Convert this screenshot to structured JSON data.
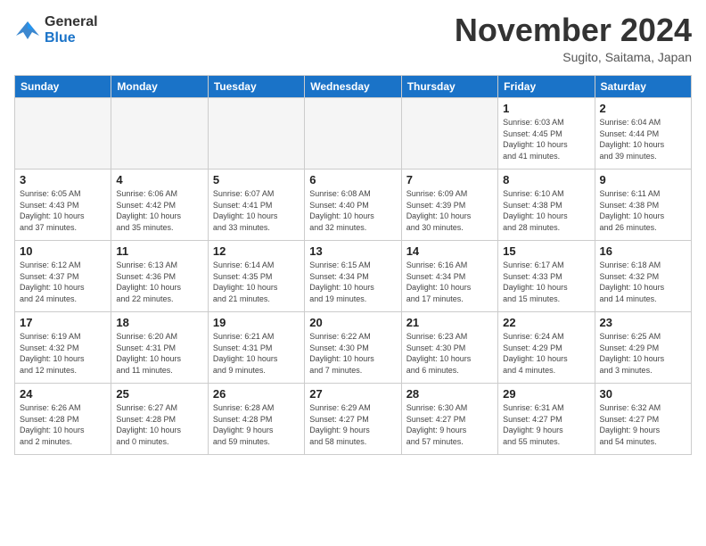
{
  "logo": {
    "line1": "General",
    "line2": "Blue"
  },
  "title": "November 2024",
  "subtitle": "Sugito, Saitama, Japan",
  "days_of_week": [
    "Sunday",
    "Monday",
    "Tuesday",
    "Wednesday",
    "Thursday",
    "Friday",
    "Saturday"
  ],
  "weeks": [
    [
      {
        "day": "",
        "info": ""
      },
      {
        "day": "",
        "info": ""
      },
      {
        "day": "",
        "info": ""
      },
      {
        "day": "",
        "info": ""
      },
      {
        "day": "",
        "info": ""
      },
      {
        "day": "1",
        "info": "Sunrise: 6:03 AM\nSunset: 4:45 PM\nDaylight: 10 hours\nand 41 minutes."
      },
      {
        "day": "2",
        "info": "Sunrise: 6:04 AM\nSunset: 4:44 PM\nDaylight: 10 hours\nand 39 minutes."
      }
    ],
    [
      {
        "day": "3",
        "info": "Sunrise: 6:05 AM\nSunset: 4:43 PM\nDaylight: 10 hours\nand 37 minutes."
      },
      {
        "day": "4",
        "info": "Sunrise: 6:06 AM\nSunset: 4:42 PM\nDaylight: 10 hours\nand 35 minutes."
      },
      {
        "day": "5",
        "info": "Sunrise: 6:07 AM\nSunset: 4:41 PM\nDaylight: 10 hours\nand 33 minutes."
      },
      {
        "day": "6",
        "info": "Sunrise: 6:08 AM\nSunset: 4:40 PM\nDaylight: 10 hours\nand 32 minutes."
      },
      {
        "day": "7",
        "info": "Sunrise: 6:09 AM\nSunset: 4:39 PM\nDaylight: 10 hours\nand 30 minutes."
      },
      {
        "day": "8",
        "info": "Sunrise: 6:10 AM\nSunset: 4:38 PM\nDaylight: 10 hours\nand 28 minutes."
      },
      {
        "day": "9",
        "info": "Sunrise: 6:11 AM\nSunset: 4:38 PM\nDaylight: 10 hours\nand 26 minutes."
      }
    ],
    [
      {
        "day": "10",
        "info": "Sunrise: 6:12 AM\nSunset: 4:37 PM\nDaylight: 10 hours\nand 24 minutes."
      },
      {
        "day": "11",
        "info": "Sunrise: 6:13 AM\nSunset: 4:36 PM\nDaylight: 10 hours\nand 22 minutes."
      },
      {
        "day": "12",
        "info": "Sunrise: 6:14 AM\nSunset: 4:35 PM\nDaylight: 10 hours\nand 21 minutes."
      },
      {
        "day": "13",
        "info": "Sunrise: 6:15 AM\nSunset: 4:34 PM\nDaylight: 10 hours\nand 19 minutes."
      },
      {
        "day": "14",
        "info": "Sunrise: 6:16 AM\nSunset: 4:34 PM\nDaylight: 10 hours\nand 17 minutes."
      },
      {
        "day": "15",
        "info": "Sunrise: 6:17 AM\nSunset: 4:33 PM\nDaylight: 10 hours\nand 15 minutes."
      },
      {
        "day": "16",
        "info": "Sunrise: 6:18 AM\nSunset: 4:32 PM\nDaylight: 10 hours\nand 14 minutes."
      }
    ],
    [
      {
        "day": "17",
        "info": "Sunrise: 6:19 AM\nSunset: 4:32 PM\nDaylight: 10 hours\nand 12 minutes."
      },
      {
        "day": "18",
        "info": "Sunrise: 6:20 AM\nSunset: 4:31 PM\nDaylight: 10 hours\nand 11 minutes."
      },
      {
        "day": "19",
        "info": "Sunrise: 6:21 AM\nSunset: 4:31 PM\nDaylight: 10 hours\nand 9 minutes."
      },
      {
        "day": "20",
        "info": "Sunrise: 6:22 AM\nSunset: 4:30 PM\nDaylight: 10 hours\nand 7 minutes."
      },
      {
        "day": "21",
        "info": "Sunrise: 6:23 AM\nSunset: 4:30 PM\nDaylight: 10 hours\nand 6 minutes."
      },
      {
        "day": "22",
        "info": "Sunrise: 6:24 AM\nSunset: 4:29 PM\nDaylight: 10 hours\nand 4 minutes."
      },
      {
        "day": "23",
        "info": "Sunrise: 6:25 AM\nSunset: 4:29 PM\nDaylight: 10 hours\nand 3 minutes."
      }
    ],
    [
      {
        "day": "24",
        "info": "Sunrise: 6:26 AM\nSunset: 4:28 PM\nDaylight: 10 hours\nand 2 minutes."
      },
      {
        "day": "25",
        "info": "Sunrise: 6:27 AM\nSunset: 4:28 PM\nDaylight: 10 hours\nand 0 minutes."
      },
      {
        "day": "26",
        "info": "Sunrise: 6:28 AM\nSunset: 4:28 PM\nDaylight: 9 hours\nand 59 minutes."
      },
      {
        "day": "27",
        "info": "Sunrise: 6:29 AM\nSunset: 4:27 PM\nDaylight: 9 hours\nand 58 minutes."
      },
      {
        "day": "28",
        "info": "Sunrise: 6:30 AM\nSunset: 4:27 PM\nDaylight: 9 hours\nand 57 minutes."
      },
      {
        "day": "29",
        "info": "Sunrise: 6:31 AM\nSunset: 4:27 PM\nDaylight: 9 hours\nand 55 minutes."
      },
      {
        "day": "30",
        "info": "Sunrise: 6:32 AM\nSunset: 4:27 PM\nDaylight: 9 hours\nand 54 minutes."
      }
    ]
  ]
}
